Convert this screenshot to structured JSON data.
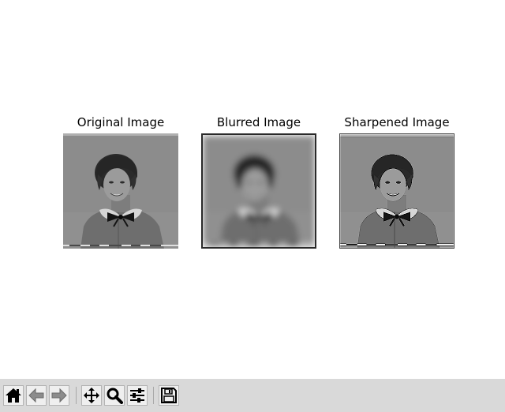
{
  "figure": {
    "subplots": [
      {
        "title": "Original Image"
      },
      {
        "title": "Blurred Image"
      },
      {
        "title": "Sharpened Image"
      }
    ]
  },
  "toolbar": {
    "buttons": [
      {
        "icon": "home-icon"
      },
      {
        "icon": "back-arrow-icon"
      },
      {
        "icon": "forward-arrow-icon"
      },
      {
        "icon": "pan-move-icon"
      },
      {
        "icon": "zoom-magnifier-icon"
      },
      {
        "icon": "configure-subplots-icon"
      },
      {
        "icon": "save-figure-icon"
      }
    ]
  },
  "colors": {
    "toolbar_bg": "#d9d9d9",
    "image_background_gray": "#8a8a8a"
  }
}
